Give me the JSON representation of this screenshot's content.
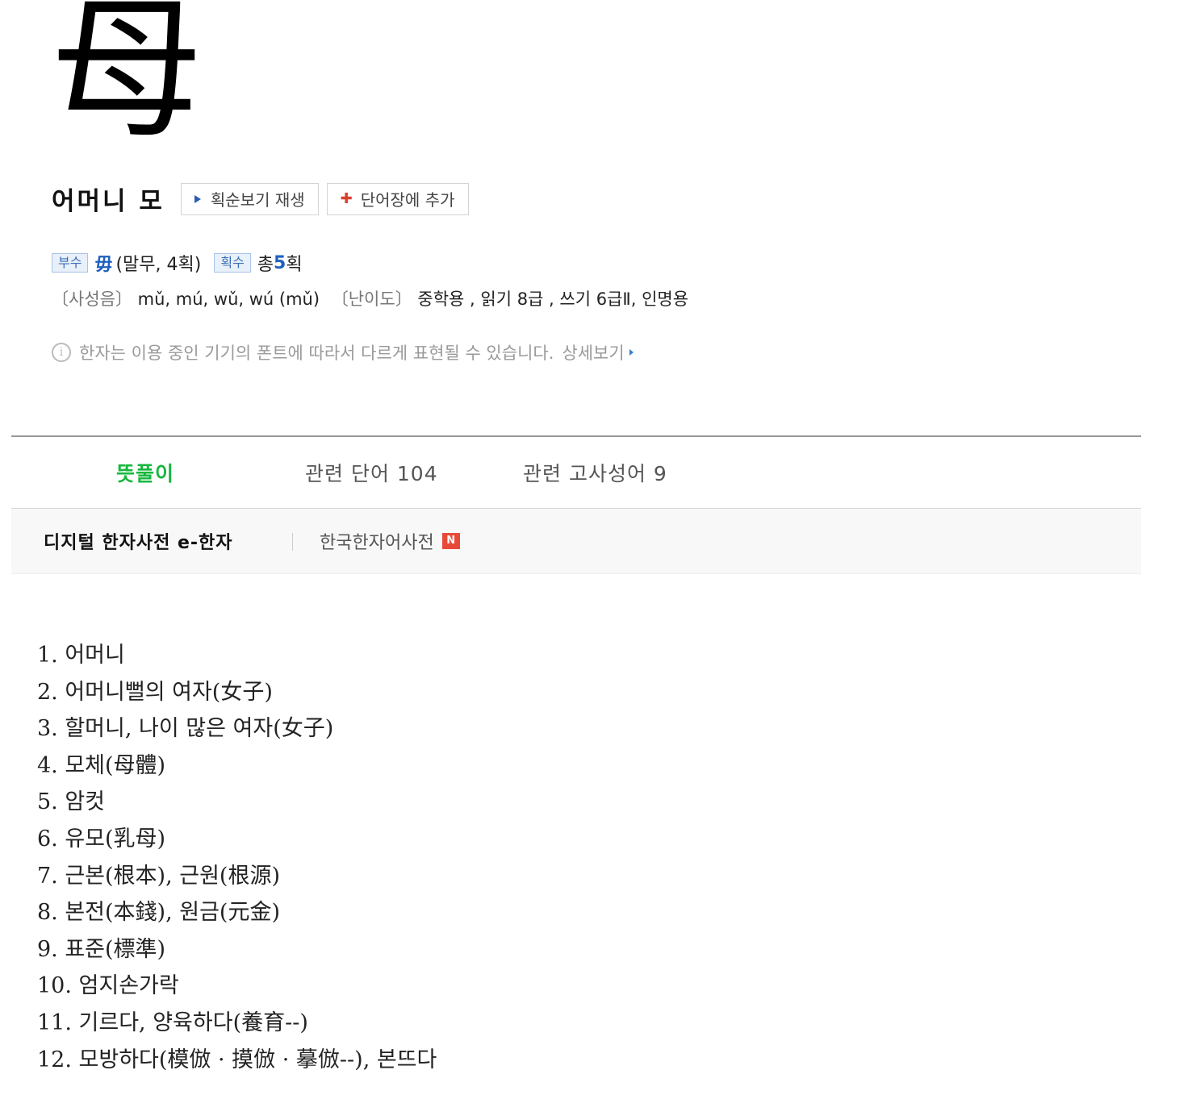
{
  "hanja": "母",
  "meaning": "어머니 모",
  "buttons": {
    "stroke_play": "획순보기 재생",
    "add_vocab": "단어장에 추가"
  },
  "info": {
    "radical_tag": "부수",
    "radical_char": "毋",
    "radical_desc": "(말무, 4획)",
    "strokes_tag": "획수",
    "strokes_prefix": "총",
    "strokes_num": "5",
    "strokes_suffix": "획",
    "pinyin_label": "〔사성음〕",
    "pinyin": "mǔ, mú, wǔ, wú (mǔ)",
    "level_label": "〔난이도〕",
    "level": "중학용 , 읽기 8급 , 쓰기 6급Ⅱ, 인명용"
  },
  "notice": {
    "text": "한자는 이용 중인 기기의 폰트에 따라서 다르게 표현될 수 있습니다.",
    "link": "상세보기"
  },
  "tabs": [
    {
      "label": "뜻풀이",
      "active": true
    },
    {
      "label": "관련 단어 104",
      "active": false
    },
    {
      "label": "관련 고사성어 9",
      "active": false
    }
  ],
  "sources": {
    "main": "디지털 한자사전 e-한자",
    "alt": "한국한자어사전",
    "alt_badge": "N"
  },
  "definitions": [
    "1. 어머니",
    "2. 어머니뻘의 여자(女子)",
    "3. 할머니, 나이 많은 여자(女子)",
    "4. 모체(母體)",
    "5. 암컷",
    "6. 유모(乳母)",
    "7. 근본(根本), 근원(根源)",
    "8. 본전(本錢), 원금(元金)",
    "9. 표준(標準)",
    "10. 엄지손가락",
    "11. 기르다, 양육하다(養育--)",
    "12. 모방하다(模倣 · 摸倣 · 摹倣--), 본뜨다"
  ]
}
